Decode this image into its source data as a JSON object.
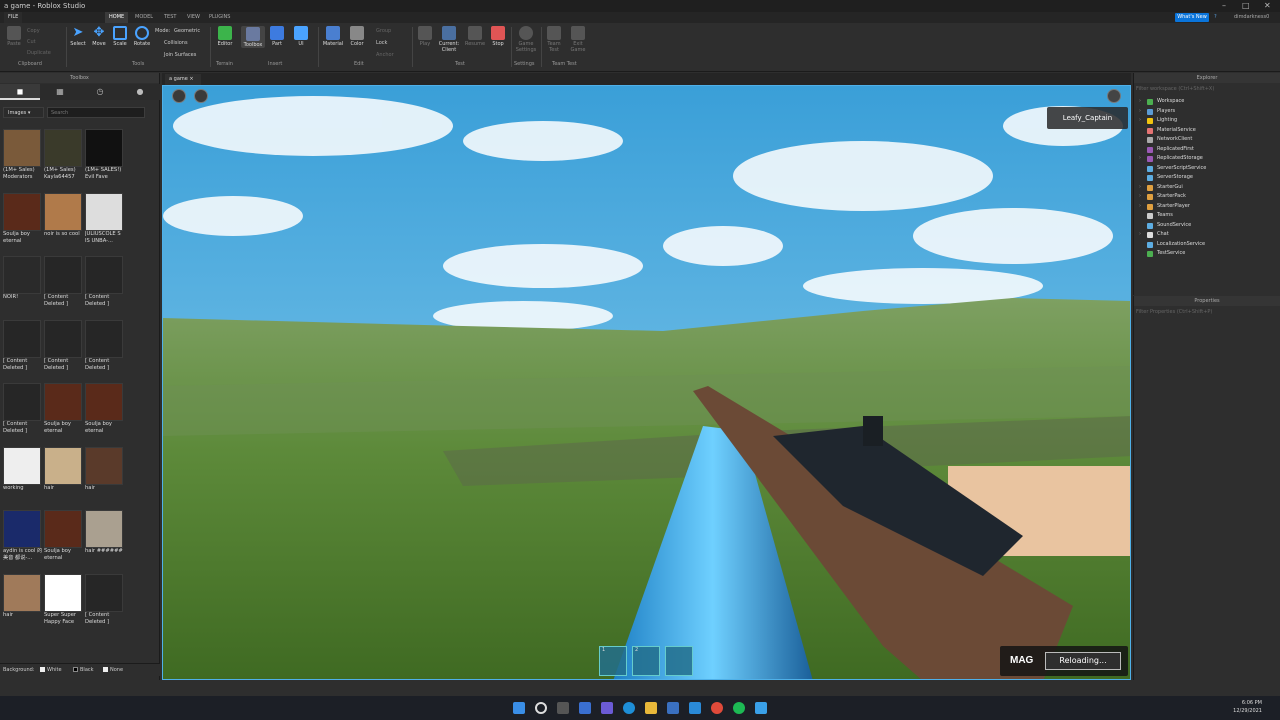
{
  "window": {
    "title": "a game - Roblox Studio"
  },
  "menu": {
    "items": [
      "FILE",
      "HOME",
      "MODEL",
      "TEST",
      "VIEW",
      "PLUGINS"
    ],
    "active": "HOME"
  },
  "topright": {
    "whats_new": "What's New",
    "user": "dimdarkness0"
  },
  "ribbon": {
    "clipboard": {
      "paste": "Paste",
      "copy": "Copy",
      "cut": "Cut",
      "duplicate": "Duplicate",
      "group_label": "Clipboard"
    },
    "tools": {
      "select": "Select",
      "move": "Move",
      "scale": "Scale",
      "rotate": "Rotate",
      "mode_label": "Mode:",
      "mode_value": "Geometric",
      "collisions": "Collisions",
      "join_surfaces": "Join Surfaces",
      "group_label": "Tools"
    },
    "terrain": {
      "editor": "Editor",
      "group_label": "Terrain"
    },
    "insert": {
      "toolbox": "Toolbox",
      "part": "Part",
      "ui": "UI",
      "group_label": "Insert"
    },
    "edit": {
      "material": "Material",
      "color": "Color",
      "group": "Group",
      "lock": "Lock",
      "anchor": "Anchor",
      "group_label": "Edit"
    },
    "test": {
      "play": "Play",
      "current_client_1": "Current:",
      "current_client_2": "Client",
      "resume": "Resume",
      "stop": "Stop",
      "group_label": "Test"
    },
    "settings": {
      "game_settings_1": "Game",
      "game_settings_2": "Settings",
      "group_label": "Settings"
    },
    "team_test": {
      "team_test_1": "Team",
      "team_test_2": "Test",
      "exit_game_1": "Exit",
      "exit_game_2": "Game",
      "group_label": "Team Test"
    }
  },
  "toolbox": {
    "title": "Toolbox",
    "category": "Images",
    "search_placeholder": "Search",
    "items": [
      {
        "label": "(1M+ Sales) Moderators",
        "color": "#7a5a3a"
      },
      {
        "label": "(1M+ Sales) Kayla64457",
        "color": "#3a3a2a"
      },
      {
        "label": "(1M+ SALES!) Evil Fave",
        "color": "#111111"
      },
      {
        "label": "Soulja boy eternal",
        "color": "#5a2a1a"
      },
      {
        "label": "noir is so cool",
        "color": "#b07a4a"
      },
      {
        "label": "JULIUSCOLE S IS UNBA-...",
        "color": "#dddddd"
      },
      {
        "label": "NOIR!",
        "color": "#2a2a2a"
      },
      {
        "label": "[ Content Deleted ]",
        "color": "#262626"
      },
      {
        "label": "[ Content Deleted ]",
        "color": "#262626"
      },
      {
        "label": "[ Content Deleted ]",
        "color": "#262626"
      },
      {
        "label": "[ Content Deleted ]",
        "color": "#262626"
      },
      {
        "label": "[ Content Deleted ]",
        "color": "#262626"
      },
      {
        "label": "[ Content Deleted ]",
        "color": "#262626"
      },
      {
        "label": "Soulja boy eternal",
        "color": "#5a2a1a"
      },
      {
        "label": "Soulja boy eternal",
        "color": "#5a2a1a"
      },
      {
        "label": "working",
        "color": "#eeeeee"
      },
      {
        "label": "hair",
        "color": "#c9b08a"
      },
      {
        "label": "hair",
        "color": "#5a3a2a"
      },
      {
        "label": "aydin is cool 的美音 都说-...",
        "color": "#1a2a6a"
      },
      {
        "label": "Soulja boy eternal",
        "color": "#5a2a1a"
      },
      {
        "label": "hair ######",
        "color": "#aaa090"
      },
      {
        "label": "hair",
        "color": "#a07a5a"
      },
      {
        "label": "Super Super Happy Face",
        "color": "#ffffff"
      },
      {
        "label": "[ Content Deleted ]",
        "color": "#262626"
      }
    ],
    "background_label": "Background:",
    "bg_white": "White",
    "bg_black": "Black",
    "bg_none": "None"
  },
  "document": {
    "tab": "a game"
  },
  "viewport": {
    "player_name": "Leafy_Captain",
    "mag_label": "MAG",
    "mag_status": "Reloading...",
    "slots": [
      "1",
      "2",
      ""
    ]
  },
  "explorer": {
    "title": "Explorer",
    "filter": "Filter workspace (Ctrl+Shift+X)",
    "items": [
      {
        "name": "Workspace",
        "color": "#4caf50",
        "arrow": true
      },
      {
        "name": "Players",
        "color": "#5b9bd5",
        "arrow": true
      },
      {
        "name": "Lighting",
        "color": "#f1c40f",
        "arrow": true
      },
      {
        "name": "MaterialService",
        "color": "#e57373",
        "arrow": false
      },
      {
        "name": "NetworkClient",
        "color": "#aaaaaa",
        "arrow": false
      },
      {
        "name": "ReplicatedFirst",
        "color": "#9b59b6",
        "arrow": false
      },
      {
        "name": "ReplicatedStorage",
        "color": "#9b59b6",
        "arrow": true
      },
      {
        "name": "ServerScriptService",
        "color": "#5dade2",
        "arrow": false
      },
      {
        "name": "ServerStorage",
        "color": "#5dade2",
        "arrow": false
      },
      {
        "name": "StarterGui",
        "color": "#e0a040",
        "arrow": true
      },
      {
        "name": "StarterPack",
        "color": "#e0a040",
        "arrow": true
      },
      {
        "name": "StarterPlayer",
        "color": "#e0a040",
        "arrow": true
      },
      {
        "name": "Teams",
        "color": "#cccccc",
        "arrow": false
      },
      {
        "name": "SoundService",
        "color": "#5dade2",
        "arrow": false
      },
      {
        "name": "Chat",
        "color": "#dddddd",
        "arrow": true
      },
      {
        "name": "LocalizationService",
        "color": "#5dade2",
        "arrow": false
      },
      {
        "name": "TestService",
        "color": "#4caf50",
        "arrow": false
      }
    ]
  },
  "properties": {
    "title": "Properties",
    "filter": "Filter Properties (Ctrl+Shift+P)"
  },
  "taskbar": {
    "time": "6:06 PM",
    "date": "12/29/2021"
  }
}
